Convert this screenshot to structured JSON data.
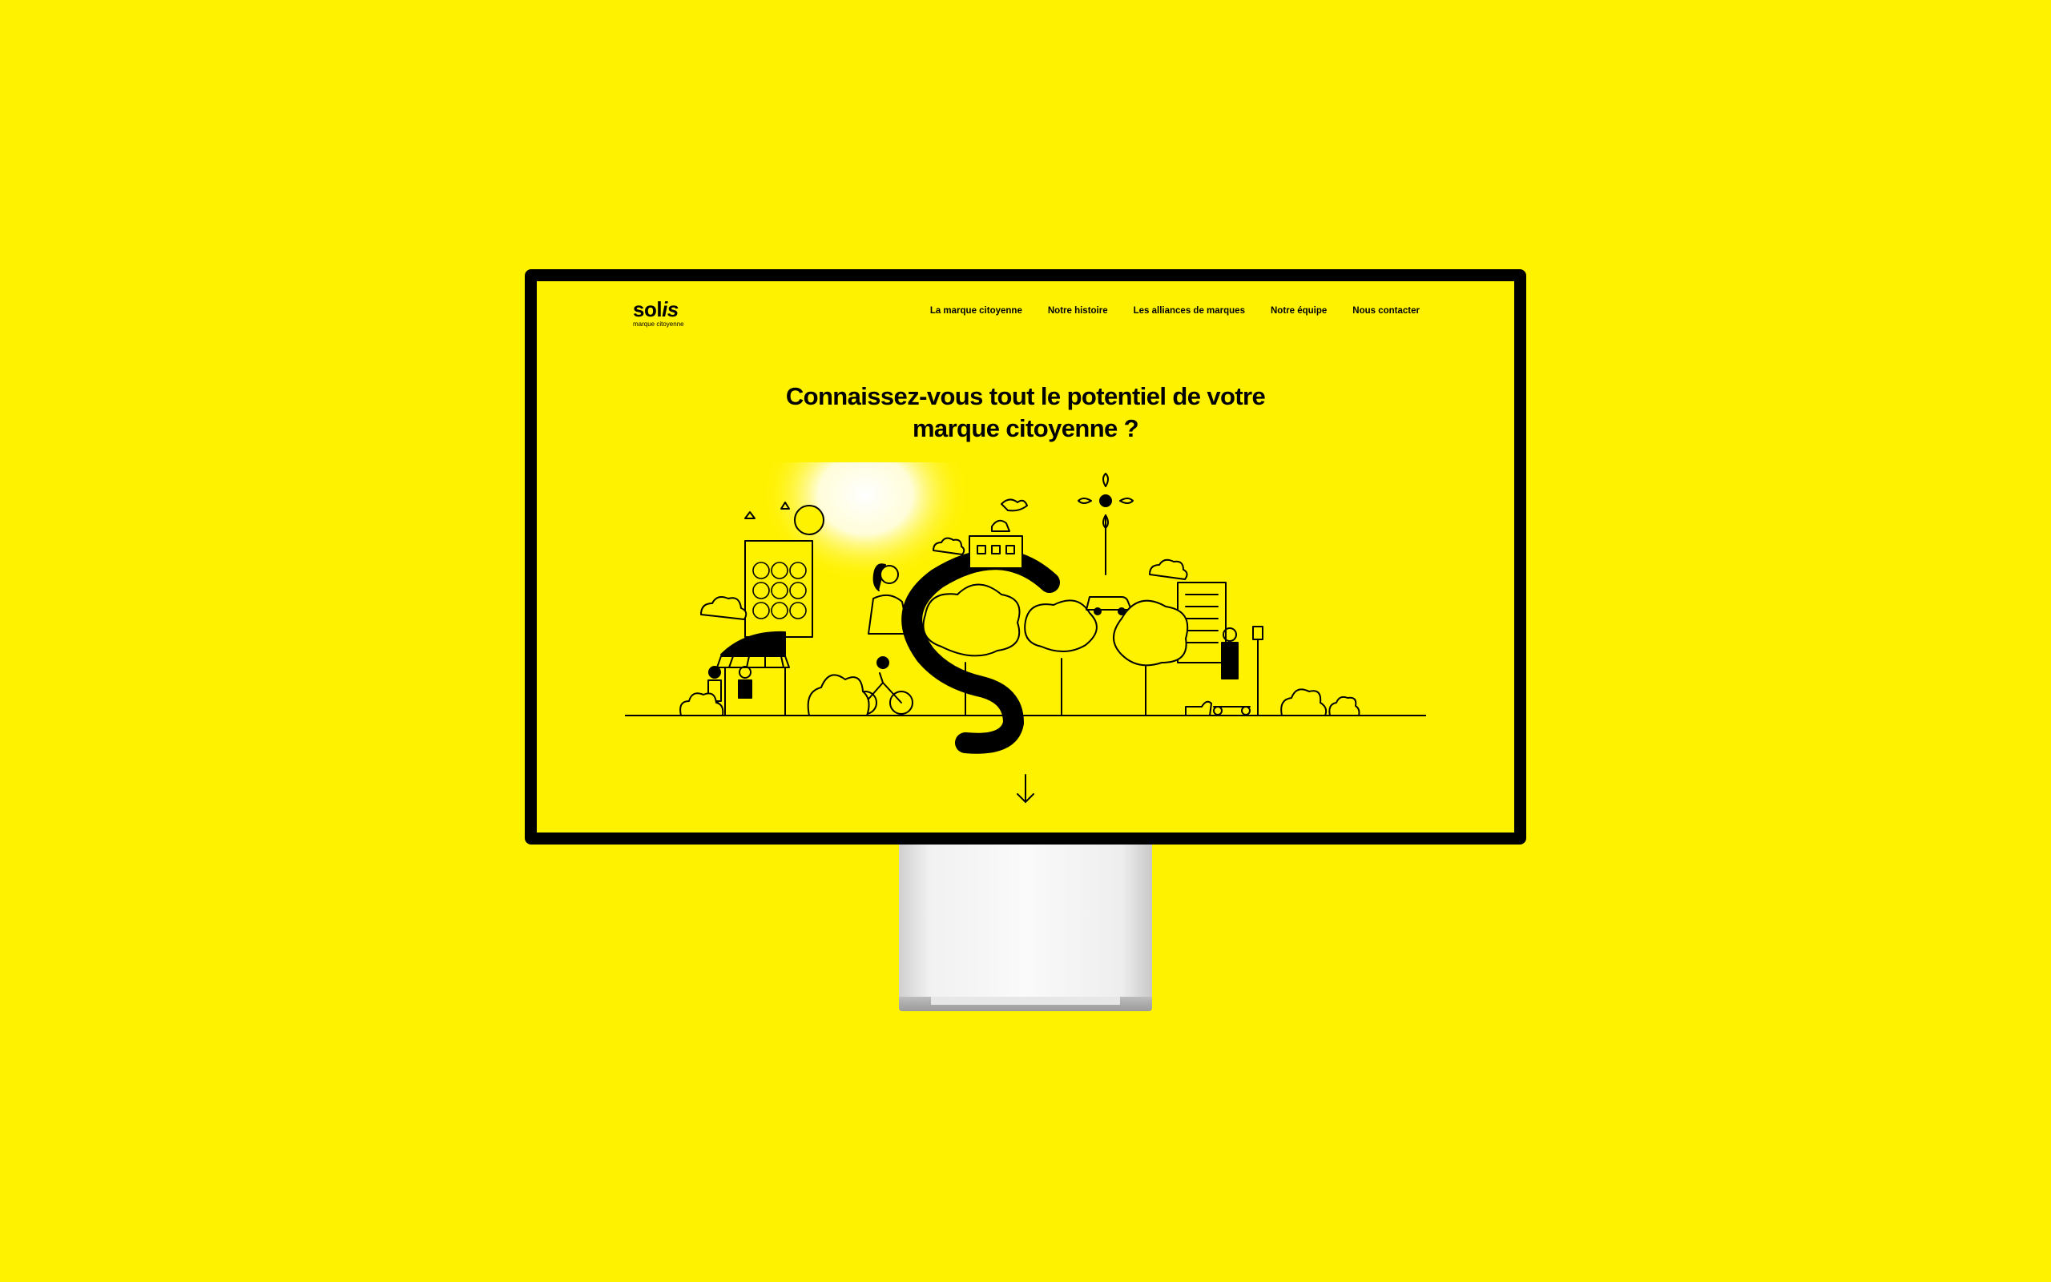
{
  "colors": {
    "background": "#fff200",
    "bezel": "#000000",
    "ink": "#000000",
    "glow": "#ffffff"
  },
  "site": {
    "logo": {
      "word_start": "sol",
      "word_end": "is",
      "tagline": "marque citoyenne"
    },
    "nav": [
      {
        "label": "La marque citoyenne"
      },
      {
        "label": "Notre histoire"
      },
      {
        "label": "Les alliances de marques"
      },
      {
        "label": "Notre équipe"
      },
      {
        "label": "Nous contacter"
      }
    ],
    "hero": {
      "line1": "Connaissez-vous tout le potentiel de votre",
      "line2": "marque citoyenne ?"
    },
    "scroll_icon": "arrow-down-icon",
    "illustration_icon": "city-illustration"
  }
}
